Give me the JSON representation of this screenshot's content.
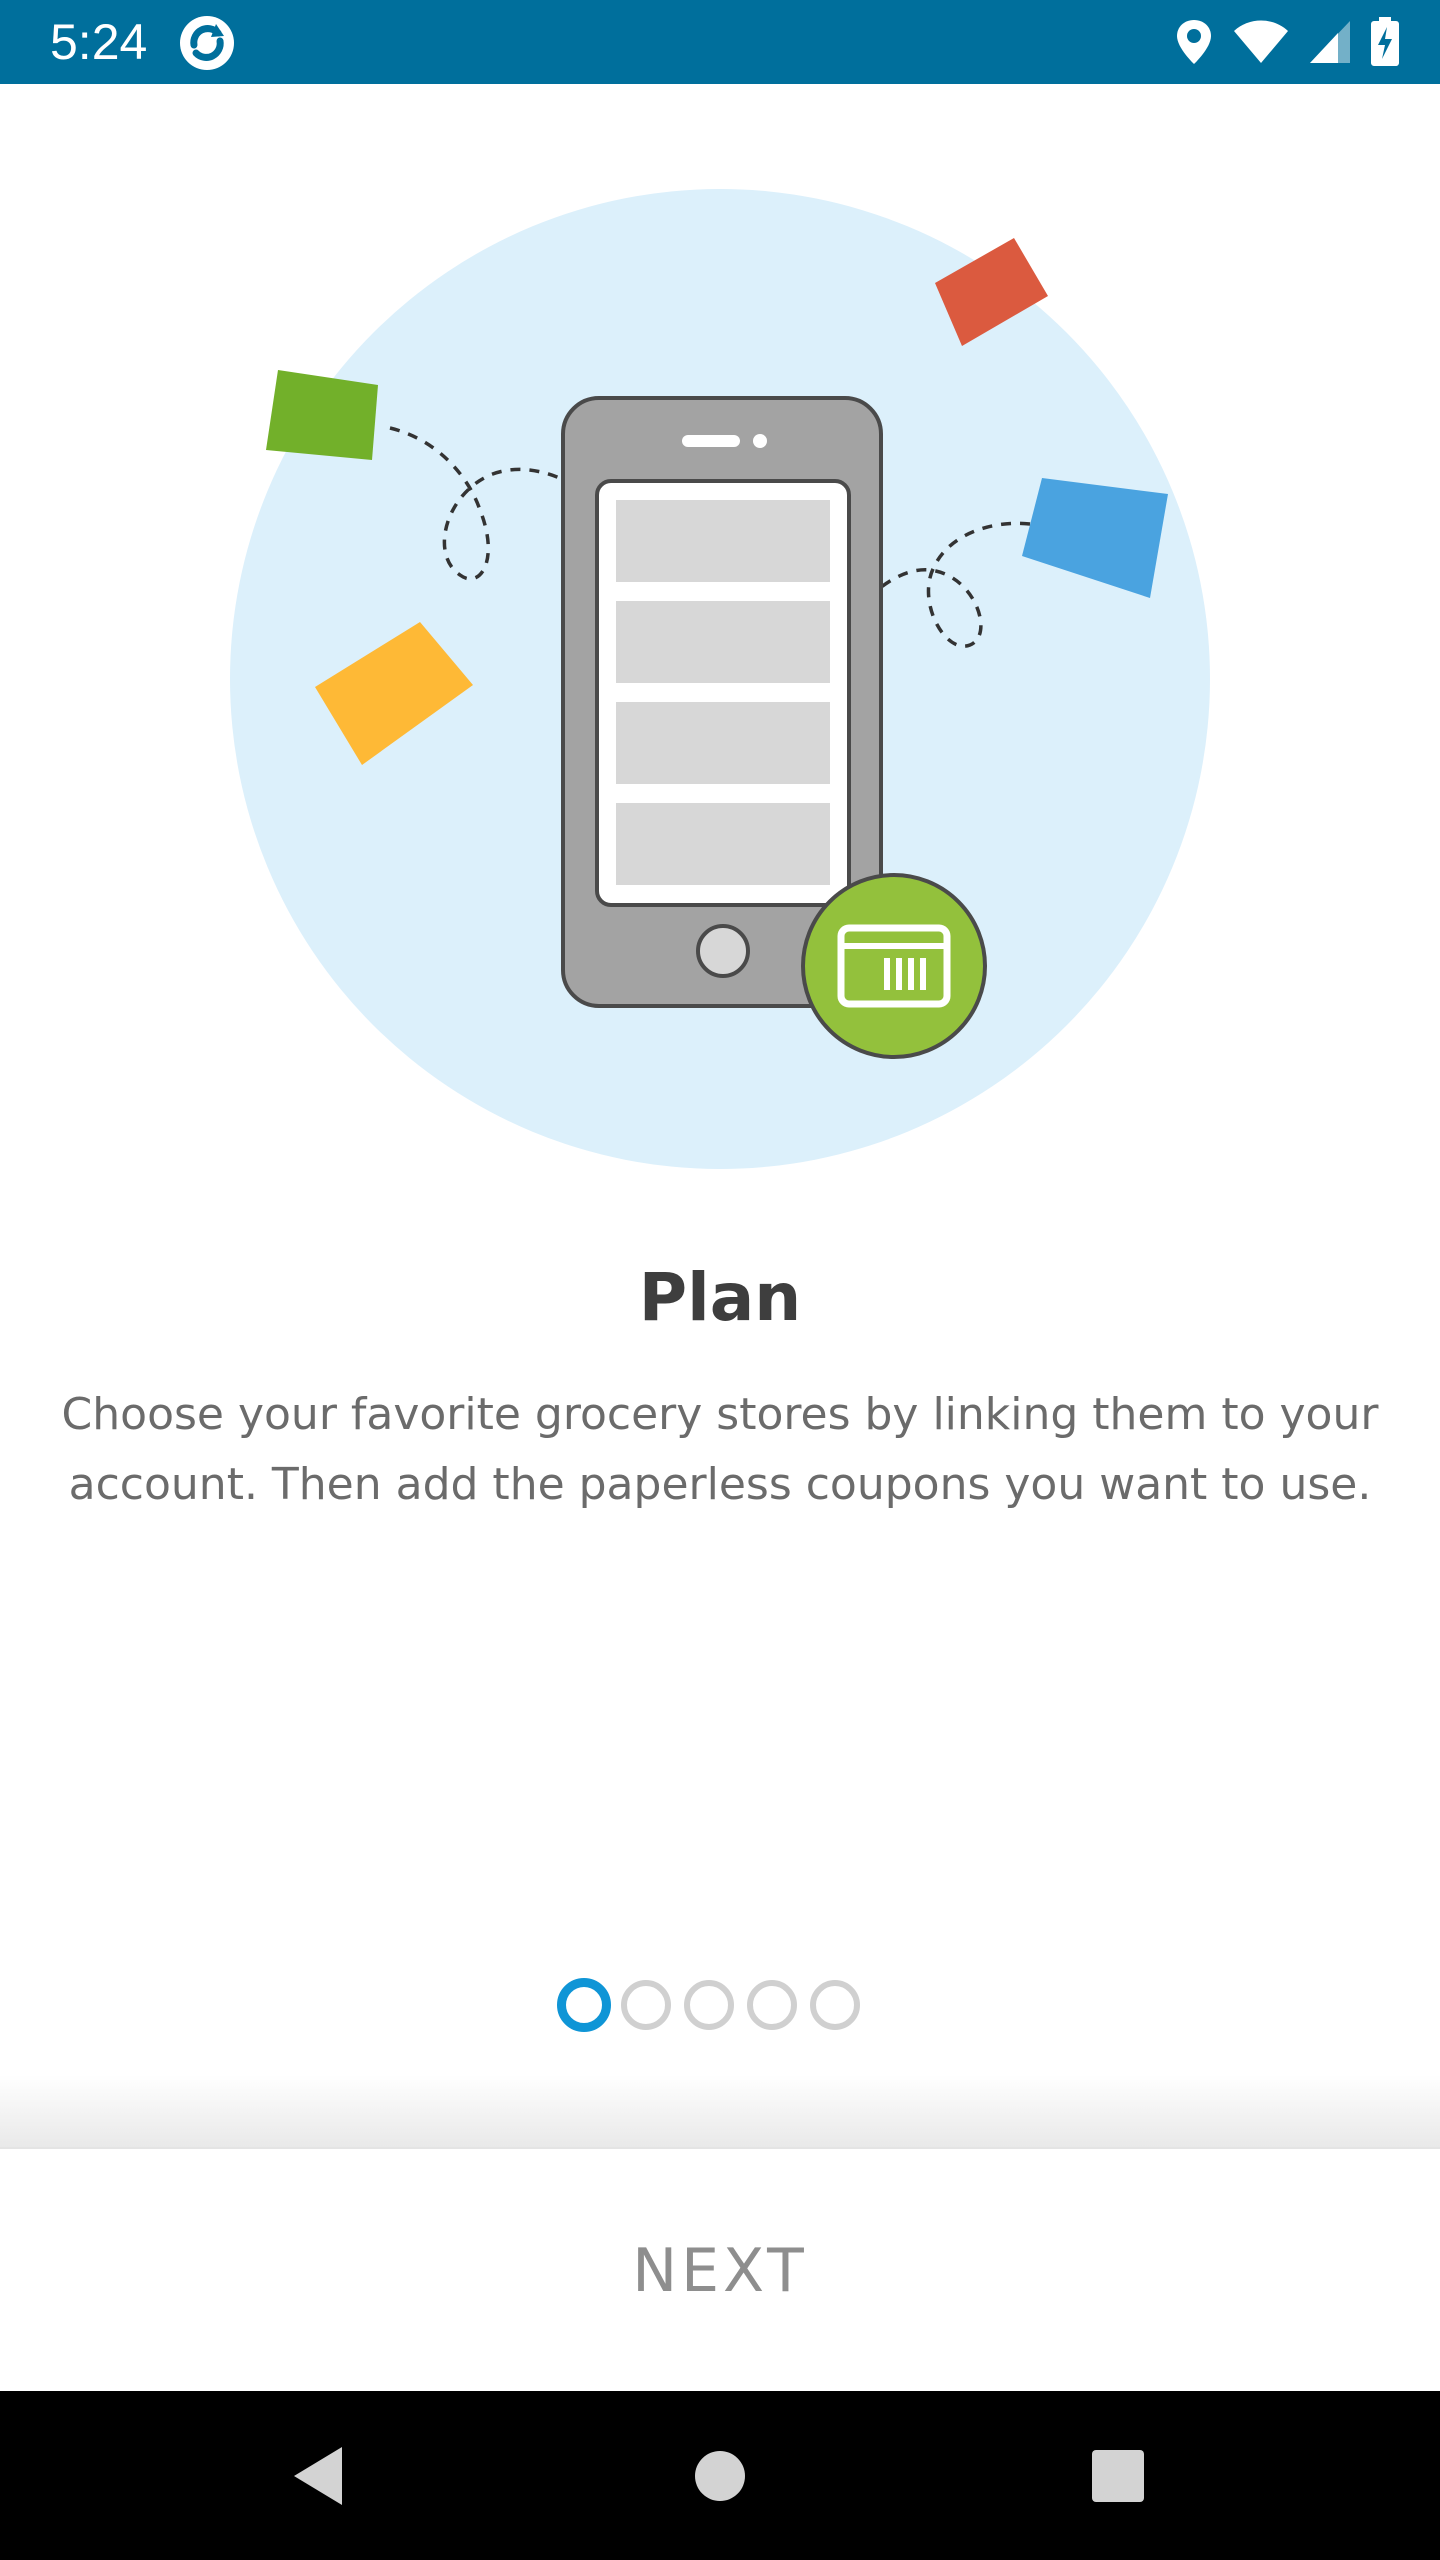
{
  "status_bar": {
    "time": "5:24",
    "app_icon": "app-refresh-icon",
    "icons": [
      "location-icon",
      "wifi-icon",
      "signal-icon",
      "battery-charging-icon"
    ],
    "background_color": "#006f9c"
  },
  "onboarding": {
    "illustration": "phone-with-coupon-card-illustration",
    "title": "Plan",
    "description": "Choose your favorite grocery stores by linking them to your account. Then add the paperless coupons you want to use.",
    "page_indicator": {
      "total": 5,
      "active_index": 0,
      "active_color": "#0f95d6"
    }
  },
  "footer": {
    "next_label": "NEXT"
  },
  "nav_bar": {
    "buttons": [
      "back-icon",
      "home-icon",
      "recents-icon"
    ]
  }
}
